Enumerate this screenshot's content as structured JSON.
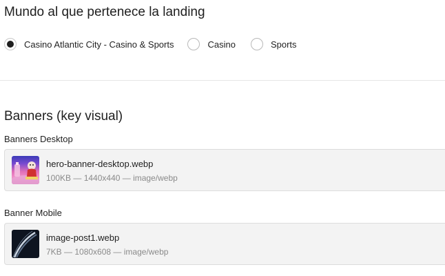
{
  "world_section": {
    "title": "Mundo al que pertenece la landing",
    "options": [
      {
        "label": "Casino Atlantic City - Casino & Sports",
        "checked": true
      },
      {
        "label": "Casino",
        "checked": false
      },
      {
        "label": "Sports",
        "checked": false
      }
    ]
  },
  "banners_section": {
    "title": "Banners (key visual)",
    "desktop": {
      "label": "Banners Desktop",
      "file_name": "hero-banner-desktop.webp",
      "file_meta": "100KB — 1440x440 — image/webp"
    },
    "mobile": {
      "label": "Banner Mobile",
      "file_name": "image-post1.webp",
      "file_meta": "7KB — 1080x608 — image/webp"
    }
  }
}
